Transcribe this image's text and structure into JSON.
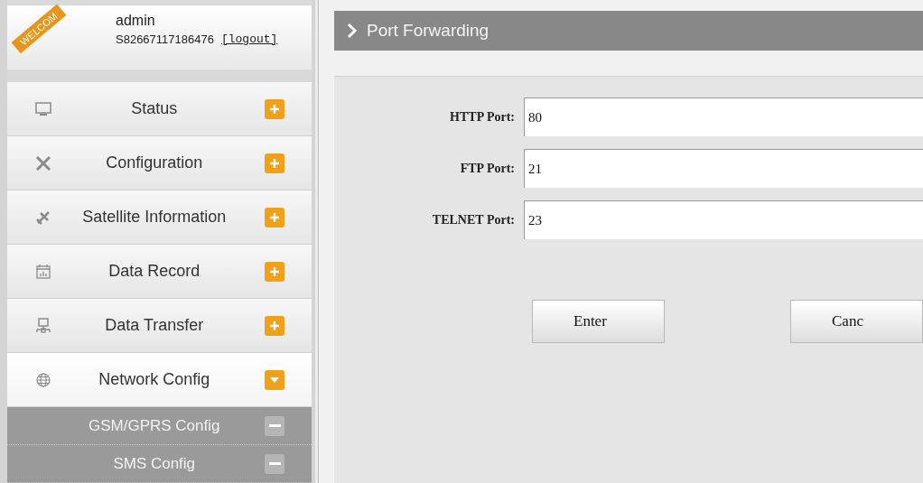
{
  "user": {
    "ribbon": "WELCOM",
    "name": "admin",
    "serial": "S82667117186476",
    "logout": "[logout]"
  },
  "menu": [
    {
      "kind": "main",
      "label": "Status",
      "expanded": false
    },
    {
      "kind": "main",
      "label": "Configuration",
      "expanded": false
    },
    {
      "kind": "main",
      "label": "Satellite Information",
      "expanded": false
    },
    {
      "kind": "main",
      "label": "Data Record",
      "expanded": false
    },
    {
      "kind": "main",
      "label": "Data Transfer",
      "expanded": false
    },
    {
      "kind": "main",
      "label": "Network Config",
      "expanded": true
    },
    {
      "kind": "sub",
      "label": "GSM/GPRS Config"
    },
    {
      "kind": "sub",
      "label": "SMS Config"
    }
  ],
  "panel": {
    "title": "Port Forwarding"
  },
  "fields": [
    {
      "label": "HTTP Port:",
      "value": "80"
    },
    {
      "label": "FTP Port:",
      "value": "21"
    },
    {
      "label": "TELNET Port:",
      "value": "23"
    }
  ],
  "buttons": [
    "Enter",
    "Canc"
  ]
}
